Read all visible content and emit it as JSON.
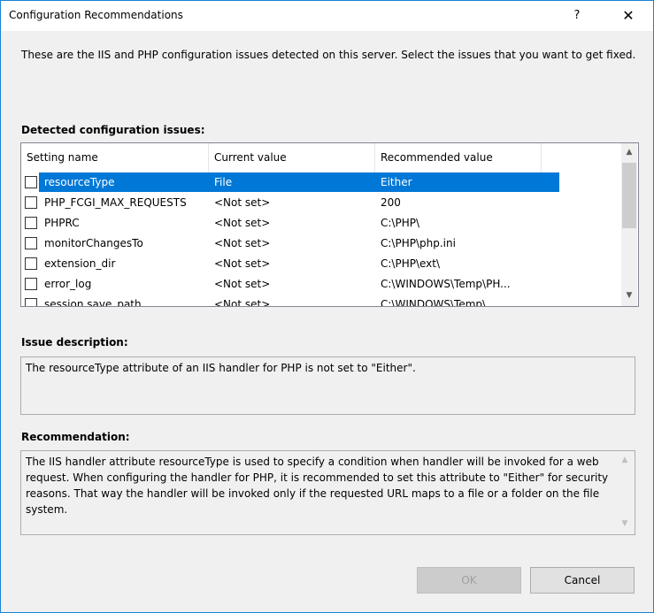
{
  "dialog": {
    "title": "Configuration Recommendations",
    "help_glyph": "?",
    "close_glyph": "✕",
    "intro": "These are the IIS and PHP configuration issues detected on this server. Select the issues that you want to get fixed."
  },
  "issues": {
    "label": "Detected configuration issues:",
    "columns": [
      "Setting name",
      "Current value",
      "Recommended value"
    ],
    "rows": [
      {
        "name": "resourceType",
        "current": "File",
        "recommended": "Either",
        "checked": false,
        "selected": true
      },
      {
        "name": "PHP_FCGI_MAX_REQUESTS",
        "current": "<Not set>",
        "recommended": "200",
        "checked": false,
        "selected": false
      },
      {
        "name": "PHPRC",
        "current": "<Not set>",
        "recommended": "C:\\PHP\\",
        "checked": false,
        "selected": false
      },
      {
        "name": "monitorChangesTo",
        "current": "<Not set>",
        "recommended": "C:\\PHP\\php.ini",
        "checked": false,
        "selected": false
      },
      {
        "name": "extension_dir",
        "current": "<Not set>",
        "recommended": "C:\\PHP\\ext\\",
        "checked": false,
        "selected": false
      },
      {
        "name": "error_log",
        "current": "<Not set>",
        "recommended": "C:\\WINDOWS\\Temp\\PH...",
        "checked": false,
        "selected": false
      },
      {
        "name": "session.save_path",
        "current": "<Not set>",
        "recommended": "C:\\WINDOWS\\Temp\\",
        "checked": false,
        "selected": false
      }
    ]
  },
  "description": {
    "label": "Issue description:",
    "text": "The resourceType attribute of an IIS handler for PHP is not set to \"Either\"."
  },
  "recommendation": {
    "label": "Recommendation:",
    "text": "The IIS handler attribute resourceType is used to specify a condition when handler will be invoked for a web request. When configuring the handler for PHP, it is recommended to set this attribute to \"Either\" for security reasons. That way the handler will be invoked only if the requested URL maps to a file or a folder on the file system."
  },
  "buttons": {
    "ok": "OK",
    "cancel": "Cancel"
  },
  "colors": {
    "selection": "#0078d7",
    "window_border": "#1883d7"
  }
}
